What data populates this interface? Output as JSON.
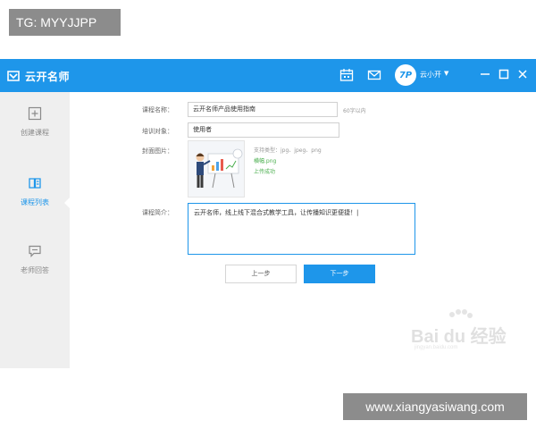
{
  "watermarks": {
    "top": "TG: MYYJJPP",
    "bottom": "www.xiangyasiwang.com"
  },
  "app": {
    "title": "云开名师",
    "user": {
      "avatar_text": "7P",
      "name": "云小开"
    },
    "titlebar_icons": [
      "calendar-icon",
      "mail-icon"
    ],
    "window_controls": [
      "minimize-icon",
      "maximize-icon",
      "close-icon"
    ]
  },
  "sidebar": {
    "items": [
      {
        "label": "创建课程",
        "icon": "plus-square-icon",
        "active": false
      },
      {
        "label": "课程列表",
        "icon": "book-list-icon",
        "active": true
      },
      {
        "label": "老师回答",
        "icon": "chat-bubble-icon",
        "active": false
      }
    ]
  },
  "form": {
    "course_name": {
      "label": "课程名称：",
      "value": "云开名师产品使用指南",
      "hint": "60字以内"
    },
    "audience": {
      "label": "培训对象：",
      "value": "使用者"
    },
    "cover": {
      "label": "封面图片：",
      "formats": "支持类型：jpg、jpeg、png",
      "filename": "横幅.png",
      "status": "上传成功"
    },
    "intro": {
      "label": "课程简介：",
      "value": "云开名师，线上线下混合式教学工具，让传播知识更便捷！"
    },
    "prev_label": "上一步",
    "next_label": "下一步"
  },
  "brand_watermark": {
    "text": "Bai du 经验",
    "sub": "jingyan.baidu.com"
  },
  "colors": {
    "accent": "#1e96ea",
    "sidebar_bg": "#efefef",
    "success": "#4caf50"
  }
}
